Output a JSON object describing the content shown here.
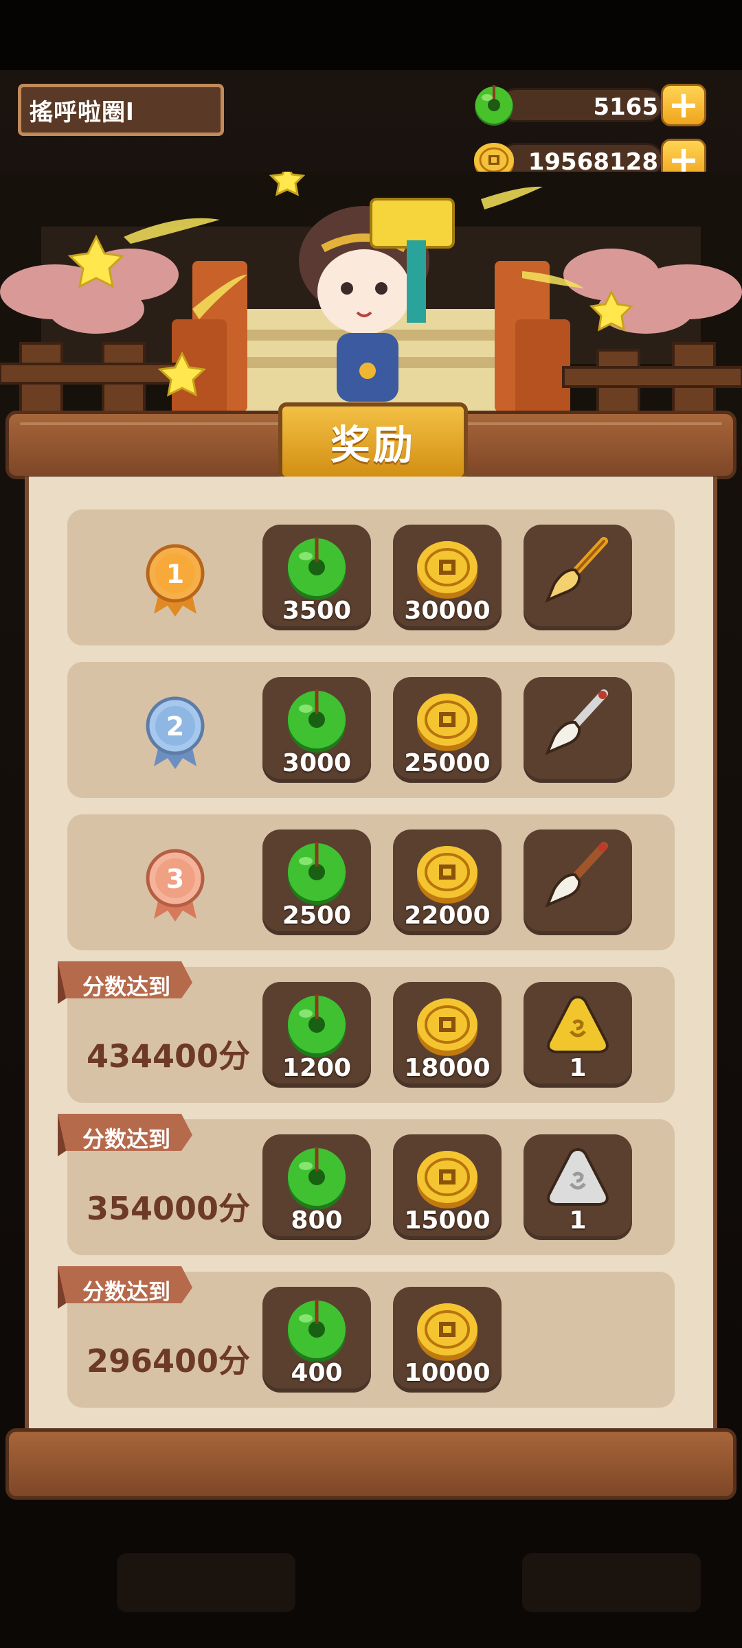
{
  "player": {
    "name": "搖呼啦圈l"
  },
  "currency": {
    "jade": {
      "icon": "green-jade-icon",
      "value": "5165",
      "plus": "+"
    },
    "coin": {
      "icon": "gold-coin-icon",
      "value": "19568128",
      "plus": "+"
    }
  },
  "dialog": {
    "title": "奖励"
  },
  "rank_rewards": [
    {
      "rank": "1",
      "medal_color": "#f3a53a",
      "jade": "3500",
      "coin": "30000",
      "third_icon": "gold-brush-icon"
    },
    {
      "rank": "2",
      "medal_color": "#8fb7e3",
      "jade": "3000",
      "coin": "25000",
      "third_icon": "silver-brush-icon"
    },
    {
      "rank": "3",
      "medal_color": "#f0a184",
      "jade": "2500",
      "coin": "22000",
      "third_icon": "bronze-brush-icon"
    }
  ],
  "score_rewards": [
    {
      "tag": "分数达到",
      "score": "434400分",
      "jade": "1200",
      "coin": "18000",
      "third_icon": "gold-triangle-token-icon",
      "third_count": "1"
    },
    {
      "tag": "分数达到",
      "score": "354000分",
      "jade": "800",
      "coin": "15000",
      "third_icon": "silver-triangle-token-icon",
      "third_count": "1"
    },
    {
      "tag": "分数达到",
      "score": "296400分",
      "jade": "400",
      "coin": "10000"
    }
  ]
}
